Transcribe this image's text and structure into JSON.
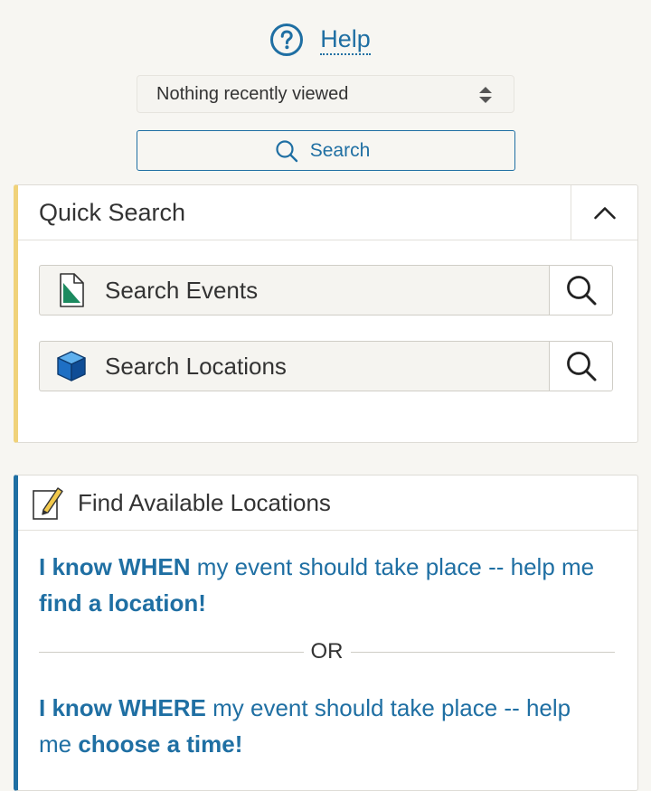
{
  "help": {
    "label": "Help",
    "icon": "question-circle-icon"
  },
  "recent": {
    "value": "Nothing recently viewed"
  },
  "search_button": {
    "label": "Search"
  },
  "quick_search": {
    "title": "Quick Search",
    "rows": [
      {
        "label": "Search Events",
        "icon": "event-document-icon"
      },
      {
        "label": "Search Locations",
        "icon": "location-cube-icon"
      }
    ]
  },
  "find_locations": {
    "title": "Find Available Locations",
    "when_link": {
      "bold1": "I know WHEN",
      "text1": " my event should take place -- help me ",
      "bold2": "find a location!"
    },
    "or_label": "OR",
    "where_link": {
      "bold1": "I know WHERE",
      "text1": " my event should take place -- help me ",
      "bold2": "choose a time!"
    }
  },
  "colors": {
    "accent_blue": "#1f6fa3",
    "quick_search_accent": "#f0d27a",
    "background": "#f7f6f2"
  }
}
